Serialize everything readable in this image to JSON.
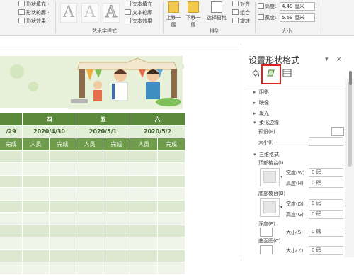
{
  "ribbon": {
    "left_items": [
      "形状填充 ·",
      "形状轮廓 ·",
      "形状效果 ·"
    ],
    "wordart_group": "艺术字样式",
    "text_items": [
      "文本填充",
      "文本轮廓",
      "文本效果"
    ],
    "arrange_buttons": [
      "上移一层",
      "下移一层",
      "选择窗格"
    ],
    "arrange_small": [
      "对齐",
      "组合",
      "旋转"
    ],
    "arrange_group": "排列",
    "height_label": "高度:",
    "height_value": "4.49 厘米",
    "width_label": "宽度:",
    "width_value": "5.69 厘米",
    "size_group": "大小"
  },
  "schedule": {
    "days": [
      "",
      "四",
      "五",
      "六"
    ],
    "dates": [
      "/29",
      "2020/4/30",
      "2020/5/1",
      "2020/5/2"
    ],
    "sub": [
      "完成",
      "人员",
      "完成",
      "人员",
      "完成",
      "人员",
      "完成"
    ]
  },
  "pane": {
    "title": "设置形状格式",
    "pin": "▾",
    "close": "×",
    "sections": [
      "阴影",
      "映像",
      "发光",
      "柔化边缘",
      "三维格式"
    ],
    "soft_edge": {
      "preset_label": "预设(P)",
      "size_label": "大小(I)"
    },
    "three_d": {
      "top_bevel": "顶部棱台(I)",
      "bottom_bevel": "底部棱台(B)",
      "width_label": "宽度(W)",
      "height_label": "高度(H)",
      "width_label2": "宽度(D)",
      "height_label2": "高度(G)",
      "value": "0 磅",
      "depth_label": "深度(E)",
      "depth_size": "大小(S)",
      "contour_label": "曲面图(C)",
      "contour_size": "大小(Z)"
    }
  }
}
